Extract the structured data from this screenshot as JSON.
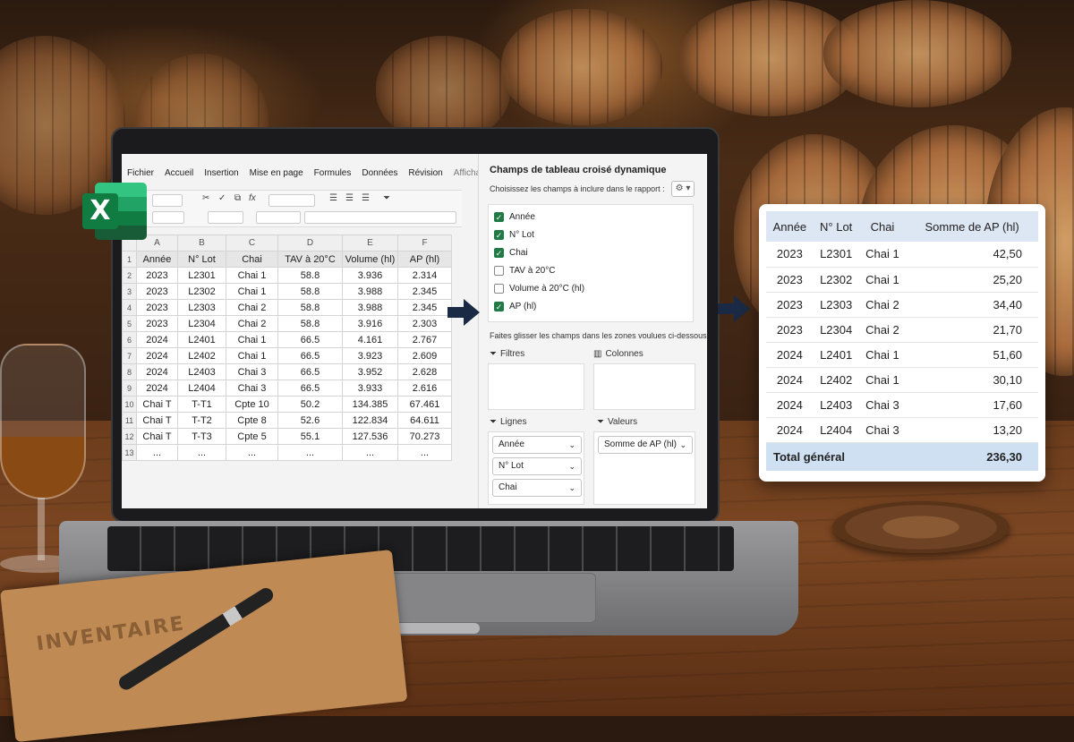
{
  "ribbon": {
    "tabs": [
      "Fichier",
      "Accueil",
      "Insertion",
      "Mise en page",
      "Formules",
      "Données",
      "Révision",
      "Affichage"
    ]
  },
  "sheet": {
    "col_letters": [
      "A",
      "B",
      "C",
      "D",
      "E",
      "F"
    ],
    "header_row": [
      "Année",
      "N° Lot",
      "Chai",
      "TAV à 20°C",
      "Volume (hl)",
      "AP (hl)"
    ],
    "rows": [
      {
        "n": "2",
        "cells": [
          "2023",
          "L2301",
          "Chai 1",
          "58.8",
          "3.936",
          "2.314"
        ]
      },
      {
        "n": "3",
        "cells": [
          "2023",
          "L2302",
          "Chai 1",
          "58.8",
          "3.988",
          "2.345"
        ]
      },
      {
        "n": "4",
        "cells": [
          "2023",
          "L2303",
          "Chai 2",
          "58.8",
          "3.988",
          "2.345"
        ]
      },
      {
        "n": "5",
        "cells": [
          "2023",
          "L2304",
          "Chai 2",
          "58.8",
          "3.916",
          "2.303"
        ]
      },
      {
        "n": "6",
        "cells": [
          "2024",
          "L2401",
          "Chai 1",
          "66.5",
          "4.161",
          "2.767"
        ]
      },
      {
        "n": "7",
        "cells": [
          "2024",
          "L2402",
          "Chai 1",
          "66.5",
          "3.923",
          "2.609"
        ]
      },
      {
        "n": "8",
        "cells": [
          "2024",
          "L2403",
          "Chai 3",
          "66.5",
          "3.952",
          "2.628"
        ]
      },
      {
        "n": "9",
        "cells": [
          "2024",
          "L2404",
          "Chai 3",
          "66.5",
          "3.933",
          "2.616"
        ]
      },
      {
        "n": "10",
        "cells": [
          "Chai T",
          "T-T1",
          "Cpte 10",
          "50.2",
          "134.385",
          "67.461"
        ]
      },
      {
        "n": "11",
        "cells": [
          "Chai T",
          "T-T2",
          "Cpte 8",
          "52.6",
          "122.834",
          "64.611"
        ]
      },
      {
        "n": "12",
        "cells": [
          "Chai T",
          "T-T3",
          "Cpte 5",
          "55.1",
          "127.536",
          "70.273"
        ]
      },
      {
        "n": "13",
        "cells": [
          "...",
          "...",
          "...",
          "...",
          "...",
          "..."
        ]
      }
    ]
  },
  "pivot_pane": {
    "title": "Champs de tableau croisé dynamique",
    "choose_label": "Choisissez les champs à inclure dans le rapport :",
    "fields": [
      {
        "label": "Année",
        "checked": true
      },
      {
        "label": "N° Lot",
        "checked": true
      },
      {
        "label": "Chai",
        "checked": true
      },
      {
        "label": "TAV à 20°C",
        "checked": false
      },
      {
        "label": "Volume à 20°C (hl)",
        "checked": false
      },
      {
        "label": "AP (hl)",
        "checked": true
      }
    ],
    "drag_label": "Faites glisser les champs dans les zones voulues ci-dessous :",
    "zones": {
      "filters": "Filtres",
      "columns": "Colonnes",
      "rows": "Lignes",
      "values": "Valeurs"
    },
    "row_fields": [
      "Année",
      "N° Lot",
      "Chai"
    ],
    "value_fields": [
      "Somme de AP (hl)"
    ]
  },
  "result_table": {
    "headers": [
      "Année",
      "N° Lot",
      "Chai",
      "Somme de AP (hl)"
    ],
    "rows": [
      [
        "2023",
        "L2301",
        "Chai 1",
        "42,50"
      ],
      [
        "2023",
        "L2302",
        "Chai 1",
        "25,20"
      ],
      [
        "2023",
        "L2303",
        "Chai 2",
        "34,40"
      ],
      [
        "2023",
        "L2304",
        "Chai 2",
        "21,70"
      ],
      [
        "2024",
        "L2401",
        "Chai 1",
        "51,60"
      ],
      [
        "2024",
        "L2402",
        "Chai 1",
        "30,10"
      ],
      [
        "2024",
        "L2403",
        "Chai 3",
        "17,60"
      ],
      [
        "2024",
        "L2404",
        "Chai 3",
        "13,20"
      ]
    ],
    "total_label": "Total général",
    "total_value": "236,30"
  },
  "props": {
    "notebook_label": "INVENTAIRE",
    "app_logo": "excel-logo"
  },
  "colors": {
    "excel_green": "#107c41",
    "pivot_header": "#dde6f3",
    "arrow": "#1a2a44"
  }
}
